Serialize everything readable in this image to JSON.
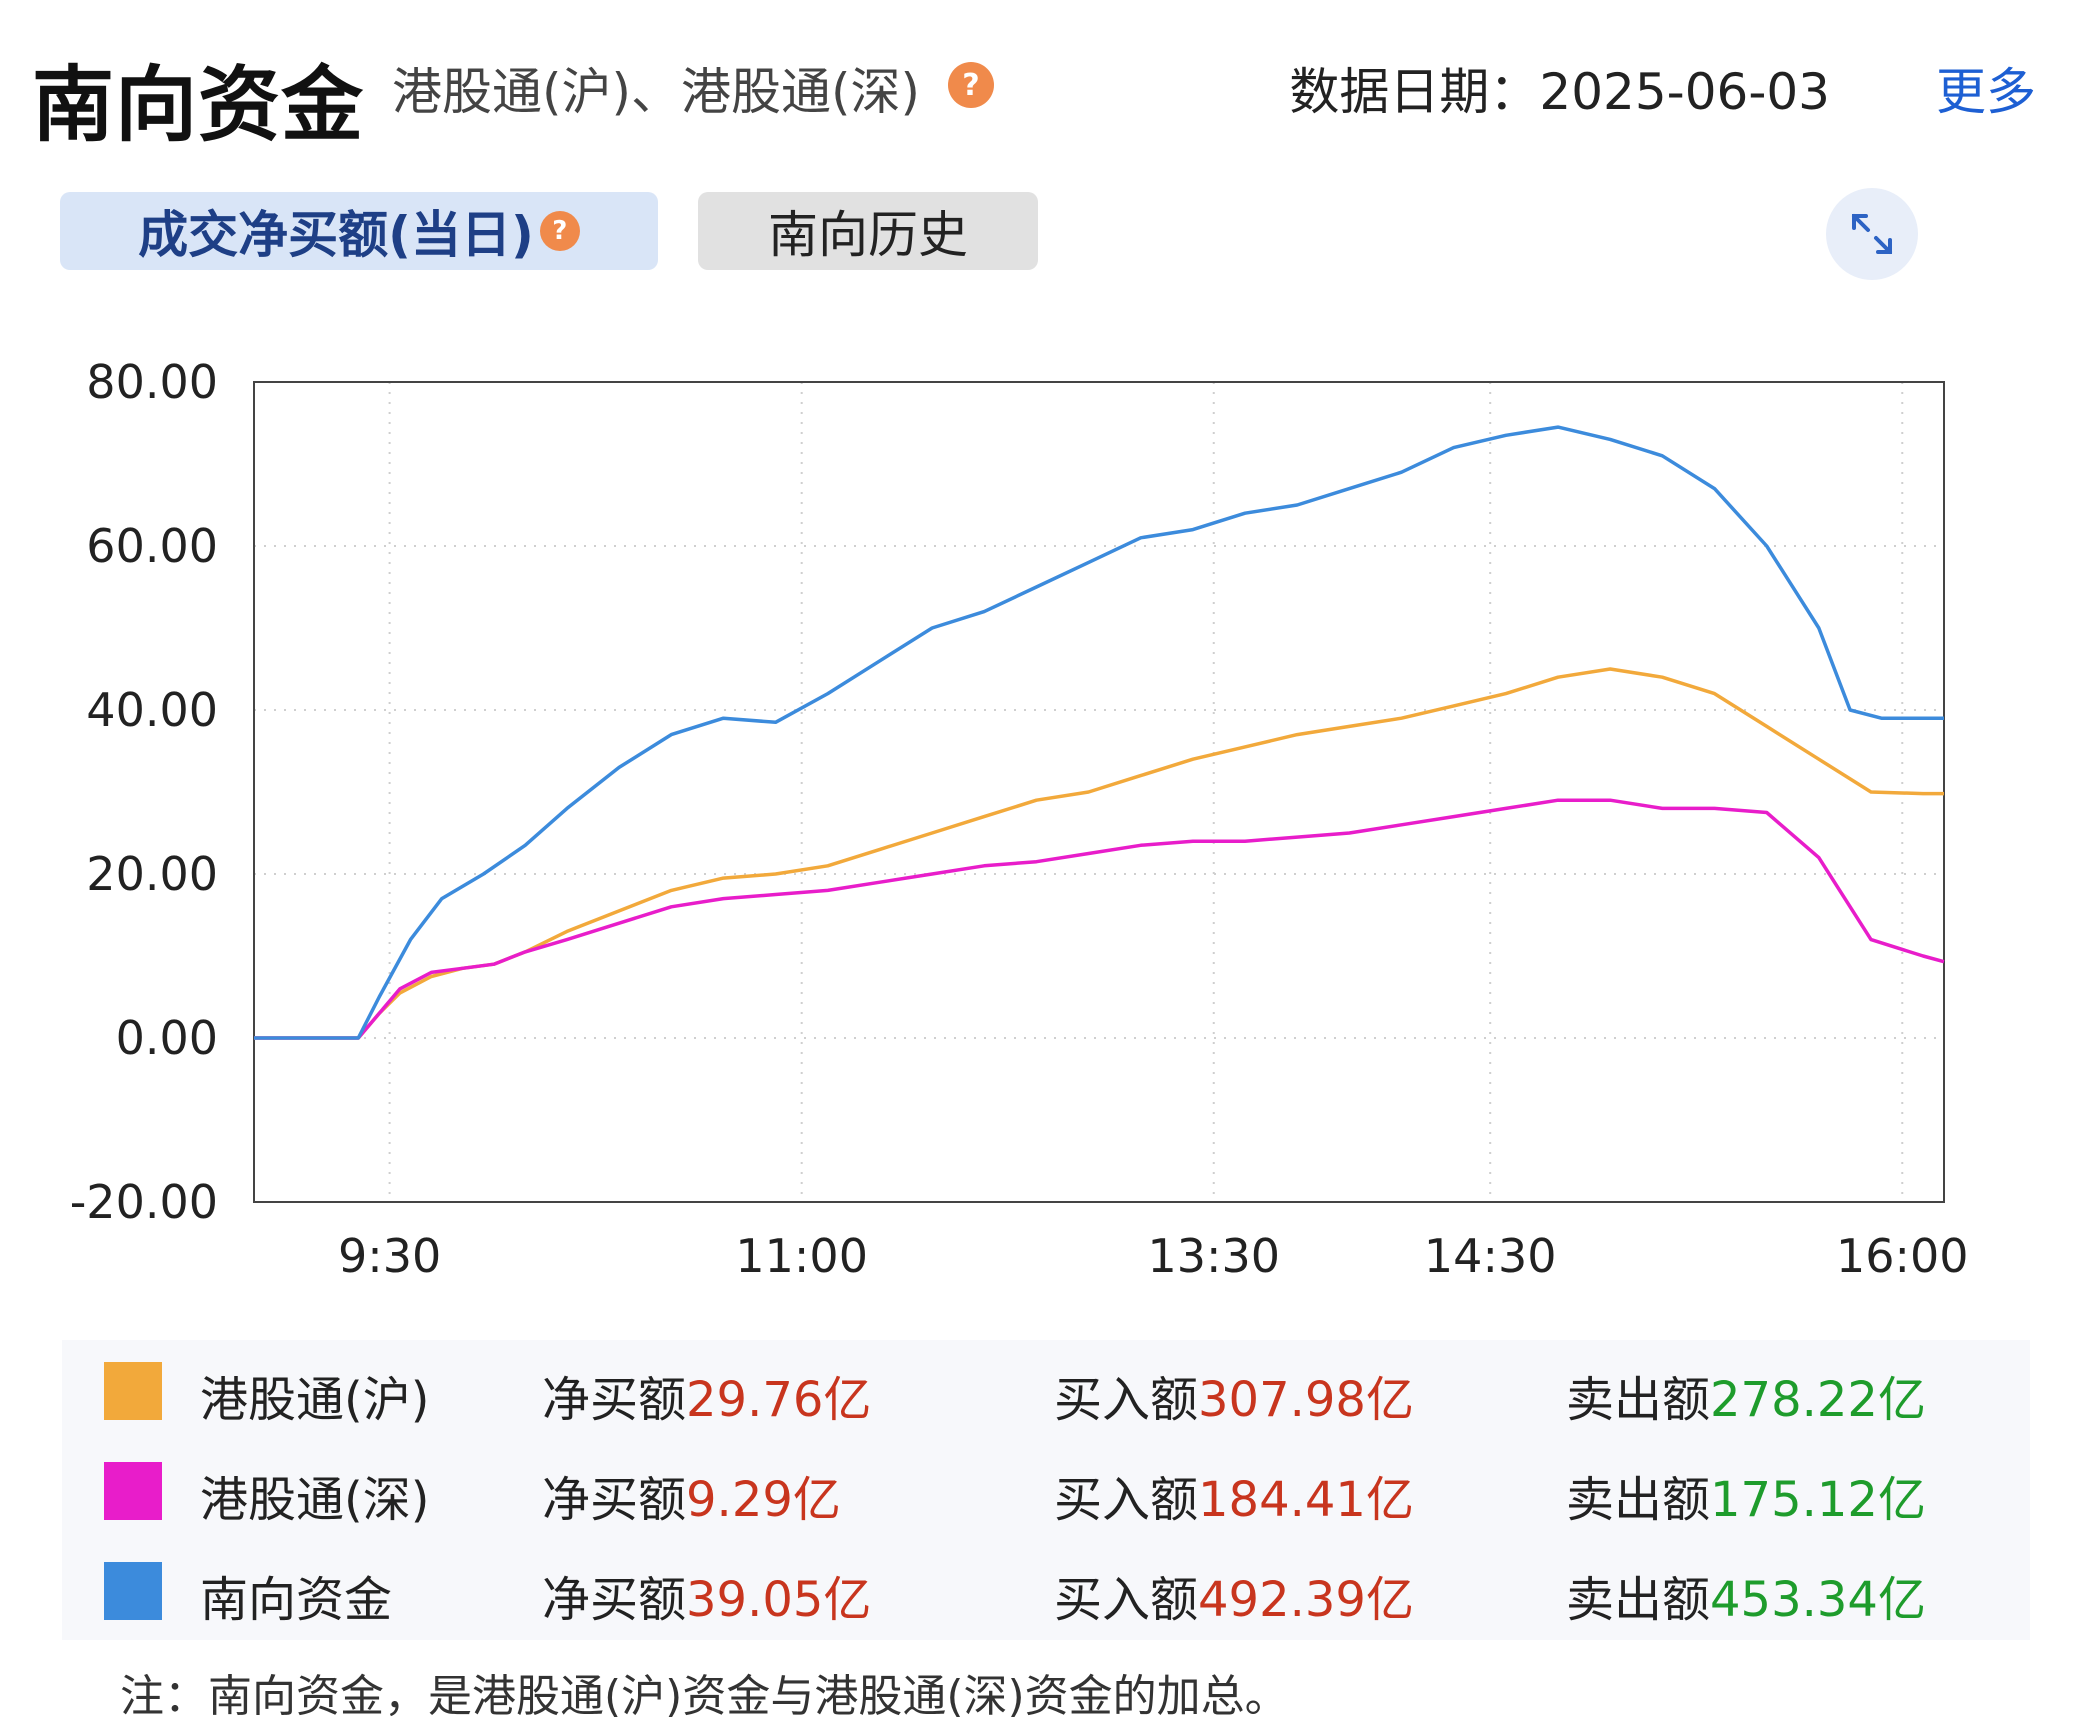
{
  "header": {
    "title": "南向资金",
    "subtitle": "港股通(沪)、港股通(深)",
    "help_glyph": "?",
    "date_text": "数据日期：2025-06-03",
    "more_label": "更多"
  },
  "tabs": [
    {
      "label": "成交净买额(当日)",
      "active": true
    },
    {
      "label": "南向历史",
      "active": false
    }
  ],
  "icons": {
    "help": "question-circle-icon",
    "expand": "expand-arrows-icon"
  },
  "chart_data": {
    "type": "line",
    "title": "",
    "xlabel": "",
    "ylabel": "",
    "ylim": [
      -20,
      80
    ],
    "yticks": [
      "80.00",
      "60.00",
      "40.00",
      "20.00",
      "0.00",
      "-20.00"
    ],
    "xticks": [
      "9:30",
      "11:00",
      "13:30",
      "14:30",
      "16:00"
    ],
    "grid": true,
    "series": [
      {
        "name": "港股通(沪)",
        "color": "#f2a93b",
        "points": [
          [
            0,
            0
          ],
          [
            0.5,
            0
          ],
          [
            1,
            0
          ],
          [
            1.2,
            3
          ],
          [
            1.4,
            5.5
          ],
          [
            1.7,
            7.5
          ],
          [
            2,
            8.5
          ],
          [
            2.3,
            9
          ],
          [
            2.6,
            10.5
          ],
          [
            3,
            13
          ],
          [
            3.5,
            15.5
          ],
          [
            4,
            18
          ],
          [
            4.5,
            19.5
          ],
          [
            5,
            20
          ],
          [
            5.5,
            21
          ],
          [
            6,
            23
          ],
          [
            6.5,
            25
          ],
          [
            7,
            27
          ],
          [
            7.5,
            29
          ],
          [
            8,
            30
          ],
          [
            8.5,
            32
          ],
          [
            9,
            34
          ],
          [
            9.5,
            35.5
          ],
          [
            10,
            37
          ],
          [
            10.5,
            38
          ],
          [
            11,
            39
          ],
          [
            11.5,
            40.5
          ],
          [
            12,
            42
          ],
          [
            12.5,
            44
          ],
          [
            13,
            45
          ],
          [
            13.5,
            44
          ],
          [
            14,
            42
          ],
          [
            14.5,
            38
          ],
          [
            15,
            34
          ],
          [
            15.5,
            30
          ],
          [
            16,
            29.8
          ],
          [
            16.2,
            29.8
          ]
        ]
      },
      {
        "name": "港股通(深)",
        "color": "#e81dca",
        "points": [
          [
            0,
            0
          ],
          [
            0.5,
            0
          ],
          [
            1,
            0
          ],
          [
            1.2,
            3
          ],
          [
            1.4,
            6
          ],
          [
            1.7,
            8
          ],
          [
            2,
            8.5
          ],
          [
            2.3,
            9
          ],
          [
            2.6,
            10.5
          ],
          [
            3,
            12
          ],
          [
            3.5,
            14
          ],
          [
            4,
            16
          ],
          [
            4.5,
            17
          ],
          [
            5,
            17.5
          ],
          [
            5.5,
            18
          ],
          [
            6,
            19
          ],
          [
            6.5,
            20
          ],
          [
            7,
            21
          ],
          [
            7.5,
            21.5
          ],
          [
            8,
            22.5
          ],
          [
            8.5,
            23.5
          ],
          [
            9,
            24
          ],
          [
            9.5,
            24
          ],
          [
            10,
            24.5
          ],
          [
            10.5,
            25
          ],
          [
            11,
            26
          ],
          [
            11.5,
            27
          ],
          [
            12,
            28
          ],
          [
            12.5,
            29
          ],
          [
            13,
            29
          ],
          [
            13.5,
            28
          ],
          [
            14,
            28
          ],
          [
            14.5,
            27.5
          ],
          [
            15,
            22
          ],
          [
            15.5,
            12
          ],
          [
            16,
            10
          ],
          [
            16.2,
            9.3
          ]
        ]
      },
      {
        "name": "南向资金",
        "color": "#3c8bdc",
        "points": [
          [
            0,
            0
          ],
          [
            0.5,
            0
          ],
          [
            1,
            0
          ],
          [
            1.2,
            5
          ],
          [
            1.5,
            12
          ],
          [
            1.8,
            17
          ],
          [
            2.2,
            20
          ],
          [
            2.6,
            23.5
          ],
          [
            3,
            28
          ],
          [
            3.5,
            33
          ],
          [
            4,
            37
          ],
          [
            4.5,
            39
          ],
          [
            5,
            38.5
          ],
          [
            5.5,
            42
          ],
          [
            6,
            46
          ],
          [
            6.5,
            50
          ],
          [
            7,
            52
          ],
          [
            7.5,
            55
          ],
          [
            8,
            58
          ],
          [
            8.5,
            61
          ],
          [
            9,
            62
          ],
          [
            9.5,
            64
          ],
          [
            10,
            65
          ],
          [
            10.5,
            67
          ],
          [
            11,
            69
          ],
          [
            11.5,
            72
          ],
          [
            12,
            73.5
          ],
          [
            12.5,
            74.5
          ],
          [
            13,
            73
          ],
          [
            13.5,
            71
          ],
          [
            14,
            67
          ],
          [
            14.5,
            60
          ],
          [
            15,
            50
          ],
          [
            15.3,
            40
          ],
          [
            15.6,
            39
          ],
          [
            16,
            39
          ],
          [
            16.2,
            39
          ]
        ]
      }
    ]
  },
  "legend": [
    {
      "name": "港股通(沪)",
      "color": "#f2a93b",
      "net_label": "净买额",
      "net_value": "29.76亿",
      "buy_label": "买入额",
      "buy_value": "307.98亿",
      "sell_label": "卖出额",
      "sell_value": "278.22亿"
    },
    {
      "name": "港股通(深)",
      "color": "#e81dca",
      "net_label": "净买额",
      "net_value": "9.29亿",
      "buy_label": "买入额",
      "buy_value": "184.41亿",
      "sell_label": "卖出额",
      "sell_value": "175.12亿"
    },
    {
      "name": "南向资金",
      "color": "#3c8bdc",
      "net_label": "净买额",
      "net_value": "39.05亿",
      "buy_label": "买入额",
      "buy_value": "492.39亿",
      "sell_label": "卖出额",
      "sell_value": "453.34亿"
    }
  ],
  "note": "注：南向资金，是港股通(沪)资金与港股通(深)资金的加总。"
}
